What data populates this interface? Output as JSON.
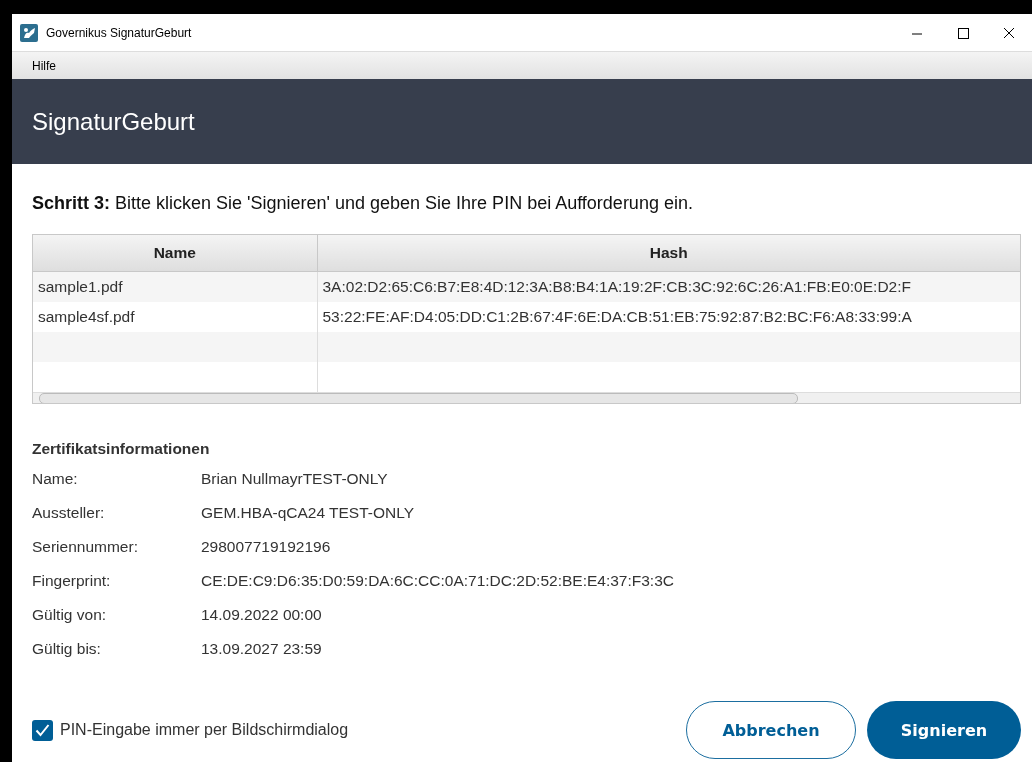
{
  "window": {
    "title": "Governikus SignaturGeburt"
  },
  "menu": [
    {
      "label": "Hilfe"
    }
  ],
  "header": {
    "title": "SignaturGeburt"
  },
  "instruction": "**Schritt 3:** Bitte klicken Sie 'Signieren' und geben Sie Ihre PIN bei Aufforderung ein.",
  "table": {
    "columns": [
      "Name",
      "Hash"
    ],
    "rows": [
      [
        "sample1.pdf",
        "3A:02:D2:65:C6:B7:E8:4D:12:3A:B8:B4:1A:19:2F:CB:3C:92:6C:26:A1:FB:E0:0E:D2:F"
      ],
      [
        "sample4sf.pdf",
        "53:22:FE:AF:D4:05:DD:C1:2B:67:4F:6E:DA:CB:51:EB:75:92:87:B2:BC:F6:A8:33:99:A"
      ]
    ]
  },
  "certificate": {
    "title": "Zertifikatsinformationen",
    "fields": [
      {
        "label": "Name:",
        "value": "Brian NullmayrTEST-ONLY"
      },
      {
        "label": "Aussteller:",
        "value": "GEM.HBA-qCA24 TEST-ONLY"
      },
      {
        "label": "Seriennummer:",
        "value": "298007719192196"
      },
      {
        "label": "Fingerprint:",
        "value": "CE:DE:C9:D6:35:D0:59:DA:6C:CC:0A:71:DC:2D:52:BE:E4:37:F3:3C"
      },
      {
        "label": "Gültig von:",
        "value": "14.09.2022 00:00"
      },
      {
        "label": "Gültig bis:",
        "value": "13.09.2027 23:59"
      }
    ]
  },
  "pin_dialog": {
    "label": "PIN-Eingabe immer per Bildschirmdialog",
    "checked": true
  },
  "buttons": [
    {
      "label": "Abbrechen",
      "kind": "secondary"
    },
    {
      "label": "Signieren",
      "kind": "primary"
    }
  ]
}
